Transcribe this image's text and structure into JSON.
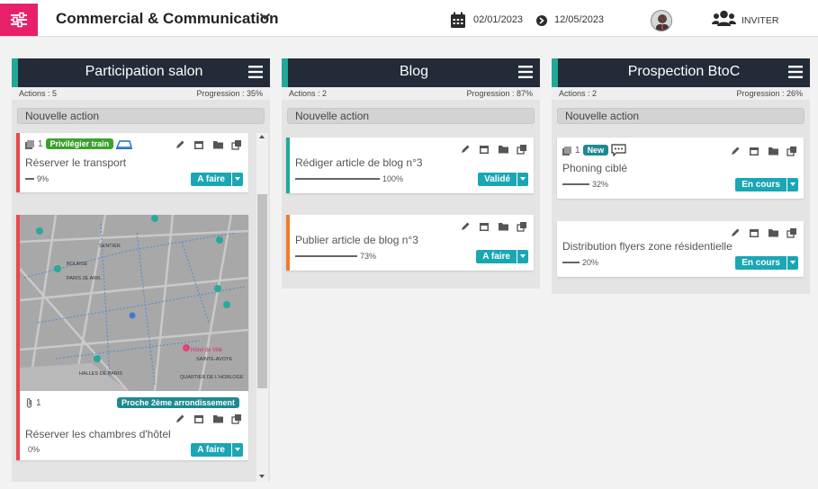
{
  "header": {
    "project_title": "Commercial & Communication",
    "date_start": "02/01/2023",
    "date_end": "12/05/2023",
    "invite_label": "INVITER"
  },
  "columns": [
    {
      "name": "Participation salon",
      "actions": "Actions : 5",
      "progress": "Progression : 35%",
      "new_action": "Nouvelle action",
      "cards": [
        {
          "count": "1",
          "tag": "Privilégier train",
          "tag_color": "#3aa12d",
          "title": "Réserver le transport",
          "progress_label": "9%",
          "progress": 0.09,
          "status": "A faire"
        },
        {
          "count": "1",
          "tag": "Proche 2ème arrondissement",
          "tag_color": "#1e8a8f",
          "title": "Réserver les chambres d'hôtel",
          "progress_label": "0%",
          "progress": 0,
          "status": "A faire",
          "map_labels": [
            "SENTIER",
            "BOURSE",
            "PARIS 2E ARR.",
            "HALLES DE PARIS",
            "QUARTIER DE L'HORLOGE",
            "SAINTE-AVOYE",
            "Hôtel de Ville"
          ]
        }
      ]
    },
    {
      "name": "Blog",
      "actions": "Actions : 2",
      "progress": "Progression : 87%",
      "new_action": "Nouvelle action",
      "cards": [
        {
          "title": "Rédiger article de blog n°3",
          "progress_label": "100%",
          "progress": 1.0,
          "status": "Validé"
        },
        {
          "title": "Publier article de blog n°3",
          "progress_label": "73%",
          "progress": 0.73,
          "status": "A faire"
        }
      ]
    },
    {
      "name": "Prospection BtoC",
      "actions": "Actions : 2",
      "progress": "Progression : 26%",
      "new_action": "Nouvelle action",
      "cards": [
        {
          "count": "1",
          "tag": "New",
          "tag_color": "#1e8a8f",
          "title": "Phoning ciblé",
          "progress_label": "32%",
          "progress": 0.32,
          "status": "En cours"
        },
        {
          "title": "Distribution flyers zone résidentielle",
          "progress_label": "20%",
          "progress": 0.2,
          "status": "En cours"
        }
      ]
    }
  ],
  "colors": {
    "accent_pink": "#e8206a",
    "column_header": "#232b38",
    "status_blue": "#1ba6b4",
    "todo_red": "#e84a4a",
    "done_green": "#21a898",
    "orange": "#f07a2e"
  }
}
